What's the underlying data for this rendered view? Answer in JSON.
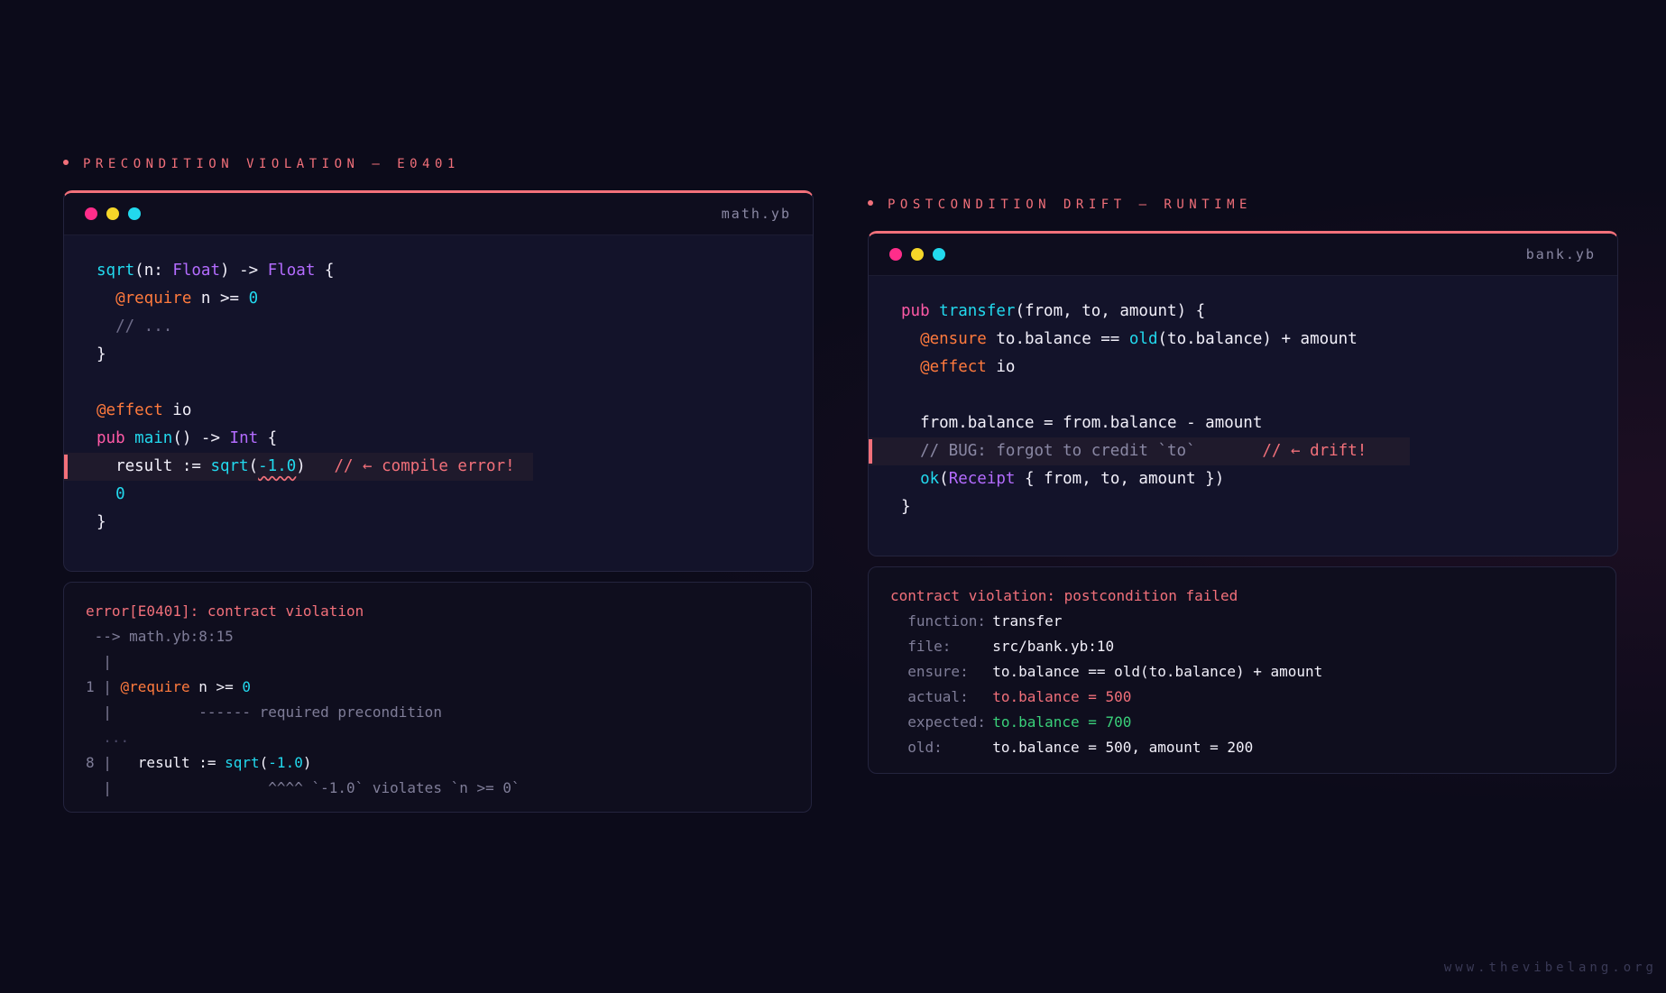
{
  "left": {
    "section_label": "PRECONDITION VIOLATION — E0401",
    "filename": "math.yb",
    "code": {
      "l1": {
        "fn": "sqrt",
        "open": "(n: ",
        "t1": "Float",
        "mid": ") -> ",
        "t2": "Float",
        "end": " {"
      },
      "l2": {
        "ann": "@require",
        "rest": " n >= ",
        "num": "0"
      },
      "l3": "// ...",
      "l4": "}",
      "l6": {
        "ann": "@effect",
        "rest": " io"
      },
      "l7": {
        "kw": "pub",
        "fn": "main",
        "mid": "() -> ",
        "ty": "Int",
        "end": " {"
      },
      "l8": {
        "pre": "result := ",
        "fn": "sqrt",
        "open": "(",
        "arg": "-1.0",
        "close": ")",
        "comment": "// ← compile error!"
      },
      "l9": "0",
      "l10": "}"
    },
    "output": {
      "l1": "error[E0401]: contract violation",
      "l2": " --> math.yb:8:15",
      "l3": "  |",
      "l4": {
        "gutter": "1 | ",
        "ann": "@require",
        "rest": " n >= ",
        "num": "0"
      },
      "l5": "  |          ------ required precondition",
      "l6": "  ...",
      "l7": {
        "gutter": "8 |   ",
        "pre": "result := ",
        "fn": "sqrt",
        "open": "(",
        "arg": "-1.0",
        "close": ")"
      },
      "l8": "  |                  ^^^^ `-1.0` violates `n >= 0`"
    }
  },
  "right": {
    "section_label": "POSTCONDITION DRIFT — RUNTIME",
    "filename": "bank.yb",
    "code": {
      "l1": {
        "kw": "pub",
        "fn": "transfer",
        "rest": "(from, to, amount) {"
      },
      "l2": {
        "ann": "@ensure",
        "a": " to.balance == ",
        "fn": "old",
        "b": "(to.balance) + amount"
      },
      "l3": {
        "ann": "@effect",
        "rest": " io"
      },
      "l5": "from.balance = from.balance - amount",
      "l6": {
        "comment": "// BUG: forgot to credit `to`",
        "drift": "// ← drift!"
      },
      "l7": {
        "fn": "ok",
        "open": "(",
        "ty": "Receipt",
        "rest": " { from, to, amount })"
      },
      "l8": "}"
    },
    "output": {
      "title": "contract violation: postcondition failed",
      "rows": [
        {
          "k": "function:",
          "v": "transfer"
        },
        {
          "k": "file:",
          "v": "src/bank.yb:10"
        },
        {
          "k": "ensure:",
          "v": "to.balance == old(to.balance) + amount"
        },
        {
          "k": "actual:",
          "v": "to.balance = 500"
        },
        {
          "k": "expected:",
          "v": "to.balance = 700"
        },
        {
          "k": "old:",
          "v": "to.balance = 500, amount = 200"
        }
      ]
    }
  },
  "footer": "www.thevibelang.org",
  "colors": {
    "accent": "#f2707a",
    "keyword": "#ff5aa6",
    "function": "#22d9ee",
    "type": "#b46cff",
    "annotation": "#ff7a3d"
  }
}
